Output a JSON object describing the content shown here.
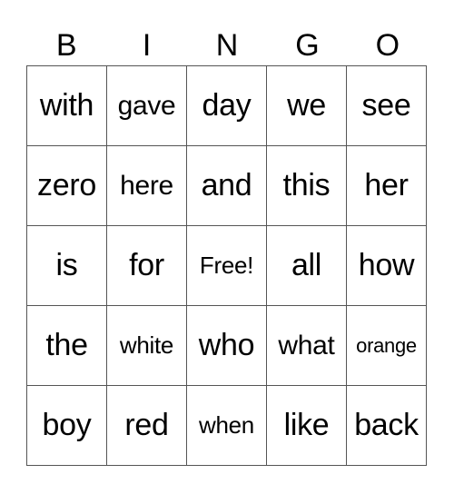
{
  "header": [
    "B",
    "I",
    "N",
    "G",
    "O"
  ],
  "rows": [
    [
      "with",
      "gave",
      "day",
      "we",
      "see"
    ],
    [
      "zero",
      "here",
      "and",
      "this",
      "her"
    ],
    [
      "is",
      "for",
      "Free!",
      "all",
      "how"
    ],
    [
      "the",
      "white",
      "who",
      "what",
      "orange"
    ],
    [
      "boy",
      "red",
      "when",
      "like",
      "back"
    ]
  ]
}
